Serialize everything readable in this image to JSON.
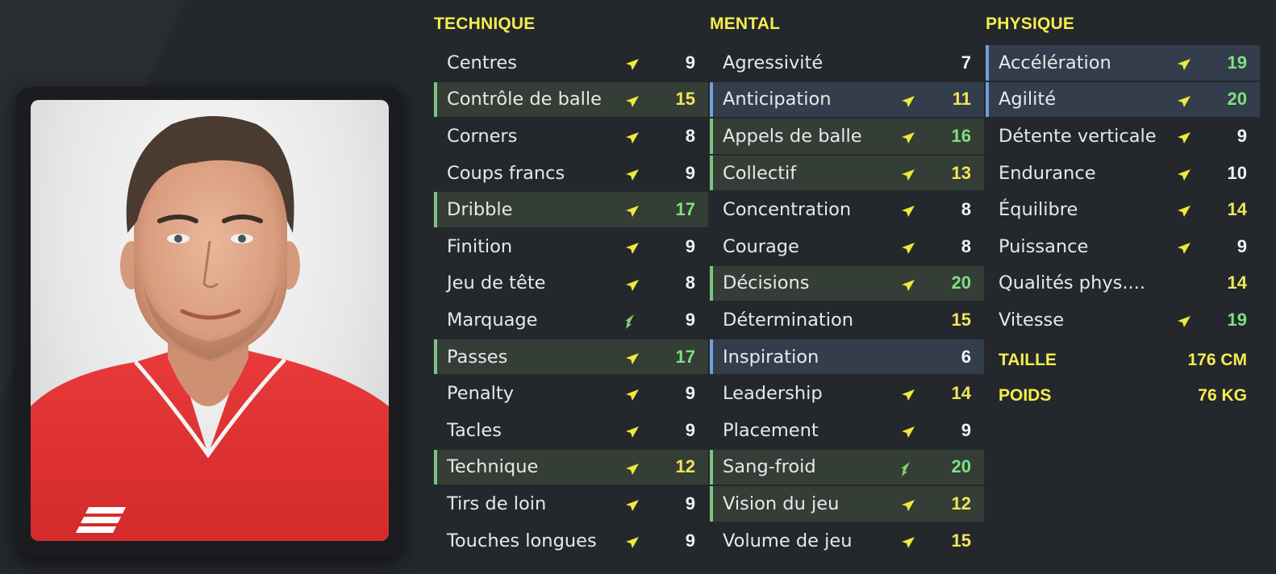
{
  "technique": {
    "title": "TECHNIQUE",
    "rows": [
      {
        "name": "Centres",
        "value": "9",
        "hl": "",
        "tone": "white",
        "arrow": "yellow"
      },
      {
        "name": "Contrôle de balle",
        "value": "15",
        "hl": "green",
        "tone": "yellow",
        "arrow": "yellow"
      },
      {
        "name": "Corners",
        "value": "8",
        "hl": "",
        "tone": "white",
        "arrow": "yellow"
      },
      {
        "name": "Coups francs",
        "value": "9",
        "hl": "",
        "tone": "white",
        "arrow": "yellow"
      },
      {
        "name": "Dribble",
        "value": "17",
        "hl": "green",
        "tone": "green",
        "arrow": "yellow"
      },
      {
        "name": "Finition",
        "value": "9",
        "hl": "",
        "tone": "white",
        "arrow": "yellow"
      },
      {
        "name": "Jeu de tête",
        "value": "8",
        "hl": "",
        "tone": "white",
        "arrow": "yellow"
      },
      {
        "name": "Marquage",
        "value": "9",
        "hl": "",
        "tone": "white",
        "arrow": "green"
      },
      {
        "name": "Passes",
        "value": "17",
        "hl": "green",
        "tone": "green",
        "arrow": "yellow"
      },
      {
        "name": "Penalty",
        "value": "9",
        "hl": "",
        "tone": "white",
        "arrow": "yellow"
      },
      {
        "name": "Tacles",
        "value": "9",
        "hl": "",
        "tone": "white",
        "arrow": "yellow"
      },
      {
        "name": "Technique",
        "value": "12",
        "hl": "green",
        "tone": "yellow",
        "arrow": "yellow"
      },
      {
        "name": "Tirs de loin",
        "value": "9",
        "hl": "",
        "tone": "white",
        "arrow": "yellow"
      },
      {
        "name": "Touches longues",
        "value": "9",
        "hl": "",
        "tone": "white",
        "arrow": "yellow"
      }
    ]
  },
  "mental": {
    "title": "MENTAL",
    "rows": [
      {
        "name": "Agressivité",
        "value": "7",
        "hl": "",
        "tone": "white",
        "arrow": "none"
      },
      {
        "name": "Anticipation",
        "value": "11",
        "hl": "blue",
        "tone": "yellow",
        "arrow": "yellow"
      },
      {
        "name": "Appels de balle",
        "value": "16",
        "hl": "green",
        "tone": "green",
        "arrow": "yellow"
      },
      {
        "name": "Collectif",
        "value": "13",
        "hl": "green",
        "tone": "yellow",
        "arrow": "yellow"
      },
      {
        "name": "Concentration",
        "value": "8",
        "hl": "",
        "tone": "white",
        "arrow": "yellow"
      },
      {
        "name": "Courage",
        "value": "8",
        "hl": "",
        "tone": "white",
        "arrow": "yellow"
      },
      {
        "name": "Décisions",
        "value": "20",
        "hl": "green",
        "tone": "green",
        "arrow": "yellow"
      },
      {
        "name": "Détermination",
        "value": "15",
        "hl": "",
        "tone": "yellow",
        "arrow": "none"
      },
      {
        "name": "Inspiration",
        "value": "6",
        "hl": "blue",
        "tone": "white",
        "arrow": "none"
      },
      {
        "name": "Leadership",
        "value": "14",
        "hl": "",
        "tone": "yellow",
        "arrow": "yellow"
      },
      {
        "name": "Placement",
        "value": "9",
        "hl": "",
        "tone": "white",
        "arrow": "yellow"
      },
      {
        "name": "Sang-froid",
        "value": "20",
        "hl": "green",
        "tone": "green",
        "arrow": "green"
      },
      {
        "name": "Vision du jeu",
        "value": "12",
        "hl": "green",
        "tone": "yellow",
        "arrow": "yellow"
      },
      {
        "name": "Volume de jeu",
        "value": "15",
        "hl": "",
        "tone": "yellow",
        "arrow": "yellow"
      }
    ]
  },
  "physique": {
    "title": "PHYSIQUE",
    "rows": [
      {
        "name": "Accélération",
        "value": "19",
        "hl": "blue",
        "tone": "green",
        "arrow": "yellow"
      },
      {
        "name": "Agilité",
        "value": "20",
        "hl": "blue",
        "tone": "green",
        "arrow": "yellow"
      },
      {
        "name": "Détente verticale",
        "value": "9",
        "hl": "",
        "tone": "white",
        "arrow": "yellow"
      },
      {
        "name": "Endurance",
        "value": "10",
        "hl": "",
        "tone": "white",
        "arrow": "yellow"
      },
      {
        "name": "Équilibre",
        "value": "14",
        "hl": "",
        "tone": "yellow",
        "arrow": "yellow"
      },
      {
        "name": "Puissance",
        "value": "9",
        "hl": "",
        "tone": "white",
        "arrow": "yellow"
      },
      {
        "name": "Qualités phys....",
        "value": "14",
        "hl": "",
        "tone": "yellow",
        "arrow": "none"
      },
      {
        "name": "Vitesse",
        "value": "19",
        "hl": "",
        "tone": "green",
        "arrow": "yellow"
      }
    ],
    "height_label": "TAILLE",
    "height_value": "176 CM",
    "weight_label": "POIDS",
    "weight_value": "76 KG"
  },
  "colors": {
    "accent_yellow": "#f2ee4d",
    "value_green": "#7fe07f",
    "value_yellow": "#f0e65a",
    "highlight_green_border": "#7cc47f",
    "highlight_blue_border": "#6ea0db",
    "background": "#24272c"
  },
  "icons": {
    "trend_arrow": "trend-arrow-icon"
  }
}
